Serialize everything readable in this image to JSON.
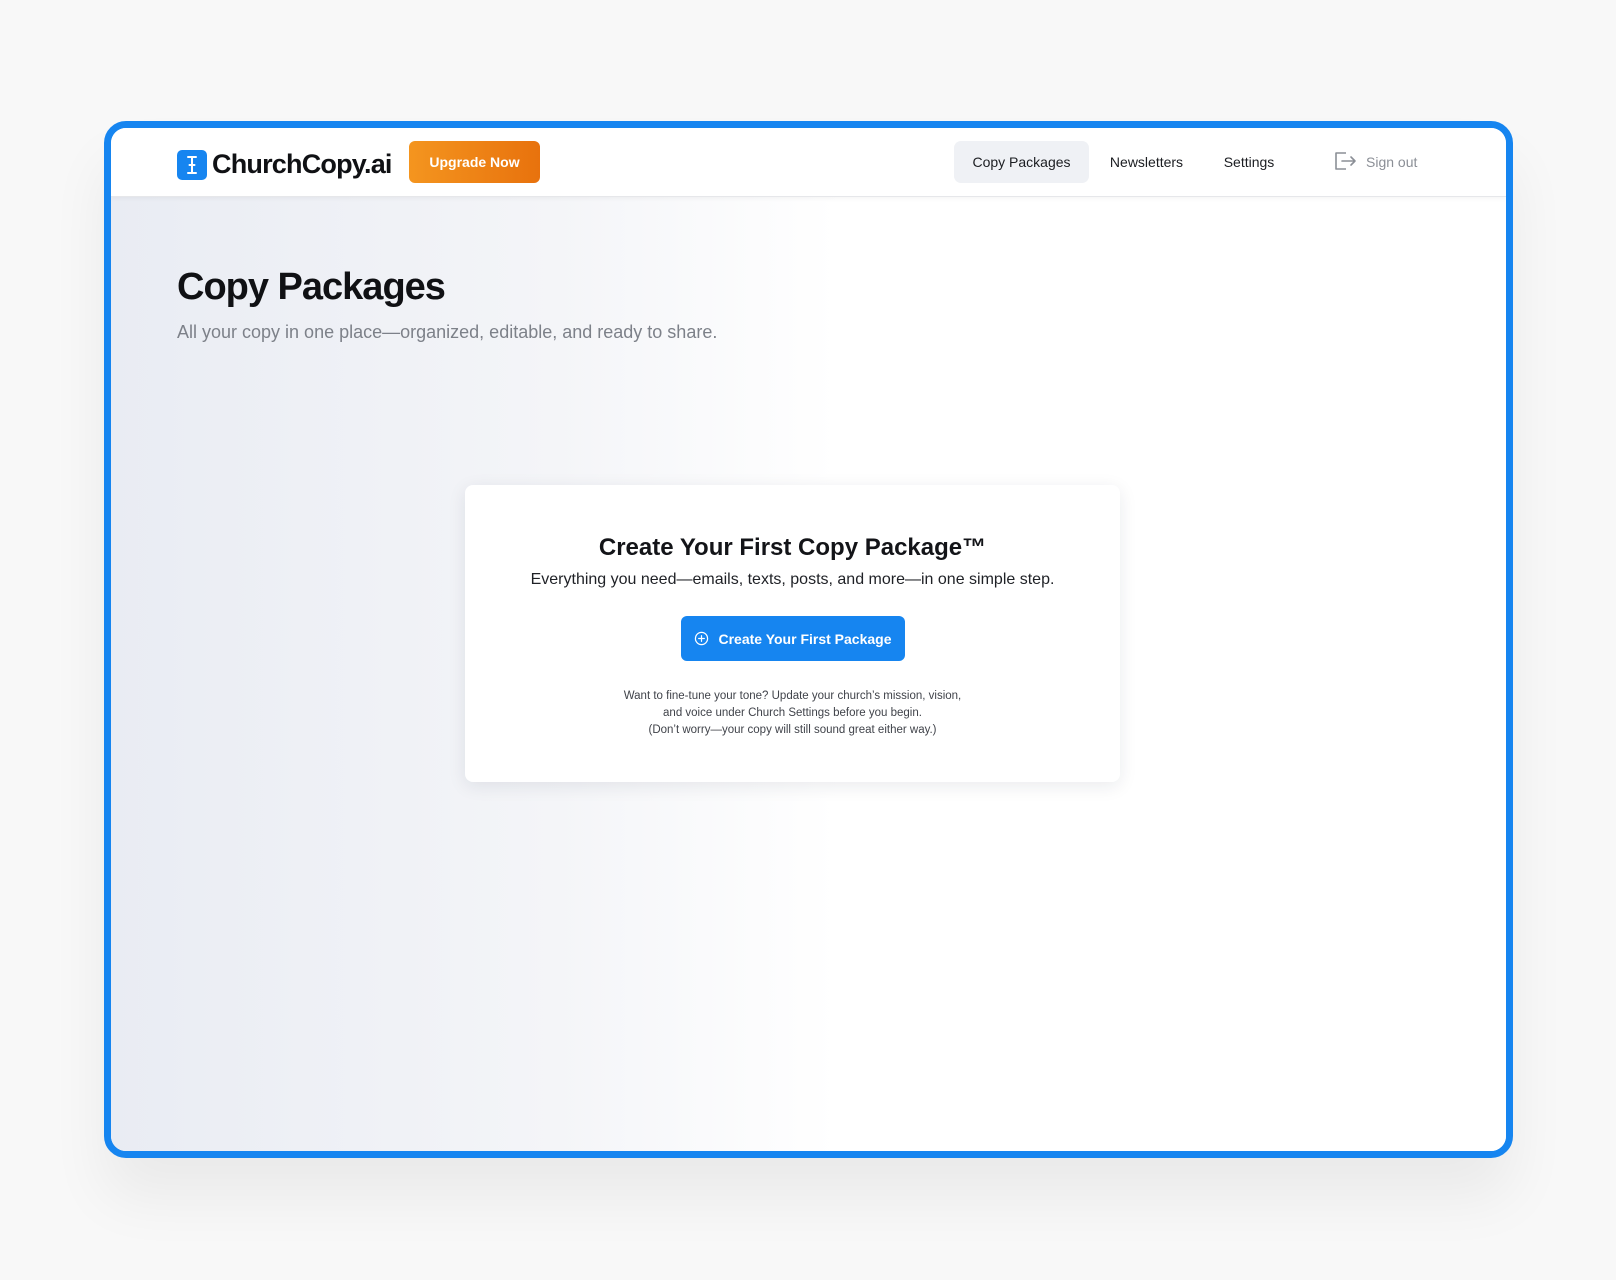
{
  "brand": {
    "name": "ChurchCopy.ai",
    "logo_icon": "cursor-text-icon"
  },
  "header": {
    "upgrade_label": "Upgrade Now",
    "nav": [
      {
        "label": "Copy Packages",
        "active": true
      },
      {
        "label": "Newsletters",
        "active": false
      },
      {
        "label": "Settings",
        "active": false
      }
    ],
    "signout_label": "Sign out",
    "signout_icon": "sign-out-icon"
  },
  "main": {
    "title": "Copy Packages",
    "subtitle": "All your copy in one place—organized, editable, and ready to share."
  },
  "empty_state": {
    "title": "Create Your First Copy Package™",
    "description": "Everything you need—emails, texts, posts, and more—in one simple step.",
    "button_label": "Create Your First Package",
    "button_icon": "plus-circle-icon",
    "note_lines": [
      "Want to fine-tune your tone? Update your church’s mission, vision,",
      "and voice under Church Settings before you begin.",
      "(Don’t worry—your copy will still sound great either way.)"
    ]
  },
  "colors": {
    "accent": "#1685f0",
    "upgrade_start": "#f4951f",
    "upgrade_end": "#e8720d"
  }
}
